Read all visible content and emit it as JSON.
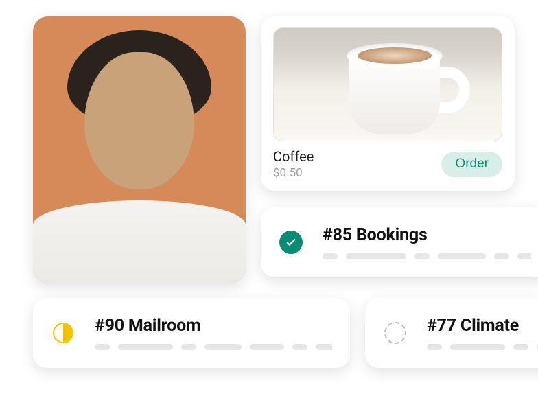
{
  "product": {
    "title": "Coffee",
    "price": "$0.50",
    "order_label": "Order"
  },
  "tickets": {
    "bookings": {
      "title": "#85 Bookings",
      "status": "done"
    },
    "mailroom": {
      "title": "#90 Mailroom",
      "status": "in-progress"
    },
    "climate": {
      "title": "#77 Climate",
      "status": "pending"
    }
  },
  "colors": {
    "accent_teal": "#0a8c74",
    "accent_yellow": "#f2c200",
    "order_bg": "#d8efe9",
    "skeleton": "#e6e6e6"
  }
}
